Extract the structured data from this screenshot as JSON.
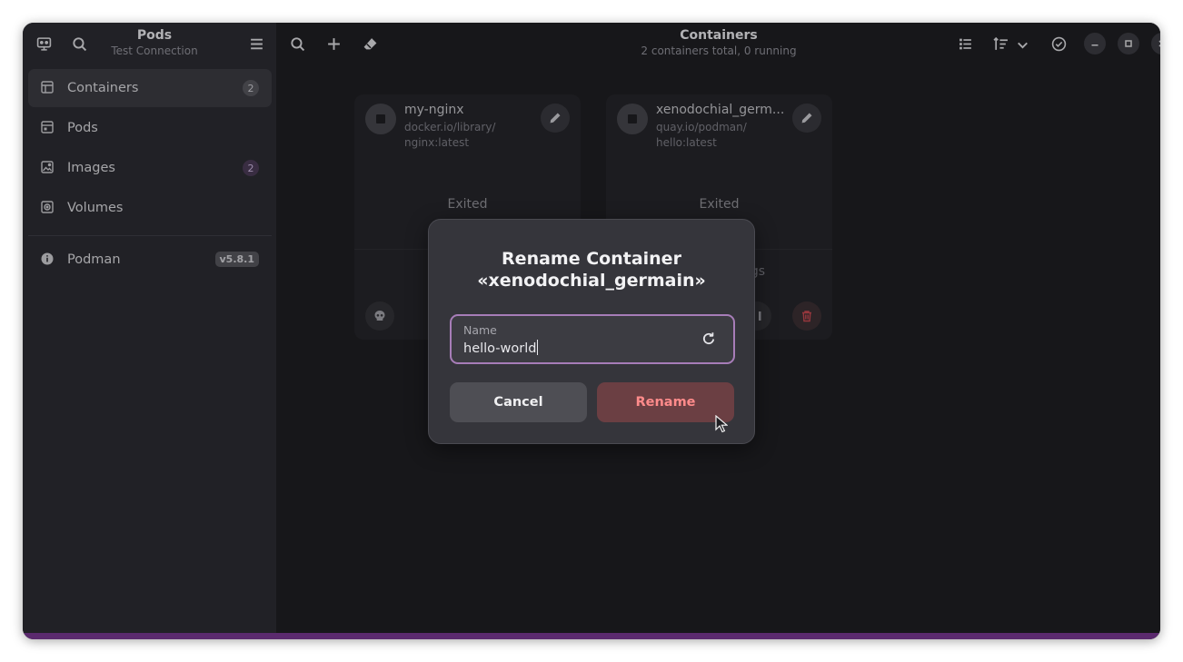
{
  "sidebar": {
    "title": "Pods",
    "subtitle": "Test Connection",
    "items": [
      {
        "label": "Containers",
        "badge": "2",
        "icon": "containers-icon"
      },
      {
        "label": "Pods",
        "badge": "",
        "icon": "pods-icon"
      },
      {
        "label": "Images",
        "badge": "2",
        "icon": "images-icon"
      },
      {
        "label": "Volumes",
        "badge": "",
        "icon": "volumes-icon"
      }
    ],
    "podman": {
      "label": "Podman",
      "version": "v5.8.1"
    }
  },
  "header": {
    "title": "Containers",
    "subtitle": "2 containers total, 0 running"
  },
  "cards": [
    {
      "name": "my-nginx",
      "image": "docker.io/library/\nnginx:latest",
      "status": "Exited",
      "footer": ""
    },
    {
      "name": "xenodochial_germ...",
      "image": "quay.io/podman/\nhello:latest",
      "status": "Exited",
      "footer": "ngs"
    }
  ],
  "dialog": {
    "title_line1": "Rename Container",
    "title_line2": "«xenodochial_germain»",
    "field_label": "Name",
    "field_value": "hello-world",
    "cancel_label": "Cancel",
    "rename_label": "Rename"
  },
  "colors": {
    "accent_border": "#a77db8",
    "destructive_text": "#ff8b8b",
    "destructive_bg": "#6b3f43",
    "bottom_bar": "#5b2a6e"
  }
}
